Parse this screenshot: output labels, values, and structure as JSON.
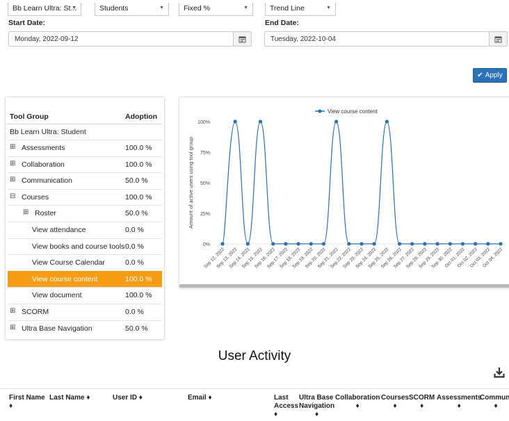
{
  "filters": {
    "tool_select": "Bb Learn Ultra: St...",
    "role_select": "Students",
    "scale_select": "Fixed %",
    "chart_type_select": "Trend Line"
  },
  "dates": {
    "start_label": "Start Date:",
    "start_value": "Monday, 2022-09-12",
    "end_label": "End Date:",
    "end_value": "Tuesday, 2022-10-04"
  },
  "apply_label": "Apply",
  "tool_table": {
    "header_group": "Tool Group",
    "header_adoption": "Adoption",
    "group_title": "Bb Learn Ultra: Student",
    "rows": [
      {
        "toggle": "⊞",
        "name": "Assessments",
        "value": "100.0 %"
      },
      {
        "toggle": "⊞",
        "name": "Collaboration",
        "value": "100.0 %"
      },
      {
        "toggle": "⊞",
        "name": "Communication",
        "value": "50.0 %"
      },
      {
        "toggle": "⊟",
        "name": "Courses",
        "value": "100.0 %"
      },
      {
        "toggle": "⊞",
        "name": "Roster",
        "value": "50.0 %"
      },
      {
        "toggle": "",
        "name": "View attendance",
        "value": "0.0 %"
      },
      {
        "toggle": "",
        "name": "View books and course tools",
        "value": "0.0 %"
      },
      {
        "toggle": "",
        "name": "View Course Calendar",
        "value": "0.0 %"
      },
      {
        "toggle": "",
        "name": "View course content",
        "value": "100.0 %"
      },
      {
        "toggle": "",
        "name": "View document",
        "value": "100.0 %"
      },
      {
        "toggle": "⊞",
        "name": "SCORM",
        "value": "0.0 %"
      },
      {
        "toggle": "⊞",
        "name": "Ultra Base Navigation",
        "value": "50.0 %"
      }
    ]
  },
  "chart_data": {
    "type": "line",
    "legend": "View course content",
    "legend_position": "top-center",
    "ylabel": "Amount of active users using tool group",
    "y_ticks": [
      "0%",
      "25%",
      "50%",
      "75%",
      "100%"
    ],
    "ylim": [
      0,
      100
    ],
    "categories": [
      "Sep 12, 2022",
      "Sep 13, 2022",
      "Sep 14, 2022",
      "Sep 15, 2022",
      "Sep 16, 2022",
      "Sep 17, 2022",
      "Sep 18, 2022",
      "Sep 19, 2022",
      "Sep 20, 2022",
      "Sep 21, 2022",
      "Sep 22, 2022",
      "Sep 23, 2022",
      "Sep 24, 2022",
      "Sep 25, 2022",
      "Sep 26, 2022",
      "Sep 27, 2022",
      "Sep 28, 2022",
      "Sep 29, 2022",
      "Sep 30, 2022",
      "Oct 01, 2022",
      "Oct 02, 2022",
      "Oct 03, 2022",
      "Oct 04, 2022"
    ],
    "series": [
      {
        "name": "View course content",
        "values": [
          0,
          100,
          0,
          100,
          0,
          0,
          0,
          0,
          0,
          100,
          0,
          0,
          0,
          100,
          0,
          0,
          0,
          0,
          0,
          0,
          0,
          0,
          0
        ]
      }
    ],
    "color": "#2a6fb0",
    "grid": false
  },
  "user_activity": {
    "title": "User Activity",
    "columns": [
      {
        "key": "first_name",
        "label": [
          "First Name",
          "♦"
        ]
      },
      {
        "key": "last_name",
        "label": [
          "Last Name ♦"
        ]
      },
      {
        "key": "user_id",
        "label": [
          "User ID ♦"
        ]
      },
      {
        "key": "email",
        "label": [
          "Email ♦"
        ]
      },
      {
        "key": "last_access",
        "label": [
          "Last",
          "Access",
          "♦"
        ]
      },
      {
        "key": "ultra_base_nav",
        "label": [
          "Ultra Base",
          "Navigation",
          "♦"
        ]
      },
      {
        "key": "collaboration",
        "label": [
          "Collaboration",
          "♦"
        ]
      },
      {
        "key": "courses",
        "label": [
          "Courses",
          "♦"
        ]
      },
      {
        "key": "scorm",
        "label": [
          "SCORM",
          "♦"
        ]
      },
      {
        "key": "assessments",
        "label": [
          "Assessments",
          "♦"
        ]
      },
      {
        "key": "communication",
        "label": [
          "Communi",
          "♦"
        ]
      }
    ]
  }
}
